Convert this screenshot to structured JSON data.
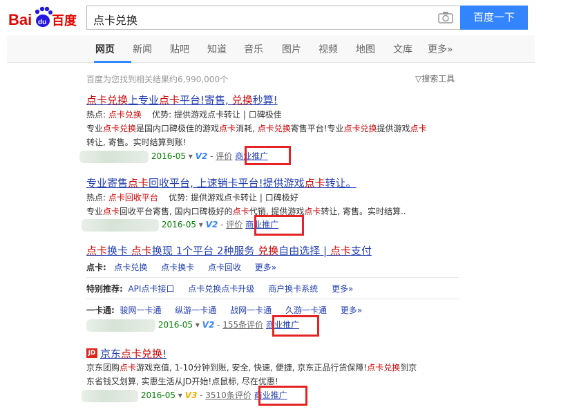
{
  "logo": {
    "part1": "Bai",
    "paw": "du",
    "part2": "百度"
  },
  "search": {
    "value": "点卡兑换",
    "button": "百度一下"
  },
  "nav": {
    "items": [
      "网页",
      "新闻",
      "贴吧",
      "知道",
      "音乐",
      "图片",
      "视频",
      "地图",
      "文库",
      "更多»"
    ],
    "active": "网页"
  },
  "results_info": {
    "count_text": "百度为您找到相关结果约6,990,000个",
    "tools": "搜索工具"
  },
  "results": [
    {
      "title": [
        "点卡兑换",
        "上专业",
        "点卡",
        "平台!寄售, ",
        "兑换",
        "秒算!"
      ],
      "hot_label": "热点:",
      "hot_value": "点卡兑换",
      "adv_label": "优势:",
      "adv_value": "提供游戏点卡转让 | 口碑极佳",
      "desc_line1": [
        "专业",
        "点卡兑换",
        "是国内口碑极佳的游戏",
        "点卡",
        "消耗, ",
        "点卡兑换",
        "寄售平台!专业",
        "点卡兑换",
        "提供游戏",
        "点卡"
      ],
      "desc_line2": "转让, 寄售。实时结算到账!",
      "date": "2016-05",
      "rating": "V2",
      "eval": "评价",
      "ad": "商业推广"
    },
    {
      "title": [
        "专业寄售",
        "点卡",
        "回收平台, 上速销卡平台!提供游戏",
        "点卡",
        "转让。"
      ],
      "hot_label": "热点:",
      "hot_value": "点卡回收平台",
      "adv_label": "优势:",
      "adv_value": "提供游戏点卡转让 | 口碑极好",
      "desc_line1": [
        "专业",
        "点卡",
        "回收平台寄售, 国内口碑极好的",
        "点卡",
        "代销, 提供游戏",
        "点卡",
        "转让, 寄售。实时结算.."
      ],
      "date": "2016-05",
      "rating": "V2",
      "eval": "评价",
      "ad": "商业推广"
    },
    {
      "title": [
        "点卡",
        "换卡 ",
        "点卡",
        "换现 1个平台 2种服务 ",
        "兑换",
        "自由选择 | ",
        "点卡",
        "支付"
      ],
      "sub1_label": "点卡:",
      "sub1_links": [
        "点卡兑换",
        "点卡换卡",
        "点卡回收",
        "更多»"
      ],
      "sub2_label": "特别推荐:",
      "sub2_links": [
        "API点卡接口",
        "点卡兑换点卡升级",
        "商户换卡系统",
        "更多»"
      ],
      "sub3_label": "一卡通:",
      "sub3_links": [
        "骏网一卡通",
        "纵游一卡通",
        "战网一卡通",
        "久游一卡通",
        "更多»"
      ],
      "date": "2016-05",
      "rating": "V2",
      "eval": "155条评价",
      "ad": "商业推广"
    },
    {
      "badge": "JD",
      "title": [
        "京东",
        "点卡兑换",
        "!"
      ],
      "desc_line1": [
        "京东团购",
        "点卡",
        "游戏充值, 1-10分钟到账, 安全, 快速, 便捷, 京东正品行货保障!",
        "点卡兑换",
        "到京"
      ],
      "desc_line2": "东省钱又划算, 实惠生活从JD开始!点鼠标, 尽在优惠!",
      "date": "2016-05",
      "rating": "V3",
      "eval": "3510条评价",
      "ad": "商业推广"
    }
  ],
  "colors": {
    "link": "#2440b3",
    "highlight": "#cc0000",
    "url_green": "#008000",
    "button_blue": "#3385ff",
    "annotation_red": "#e52323"
  }
}
